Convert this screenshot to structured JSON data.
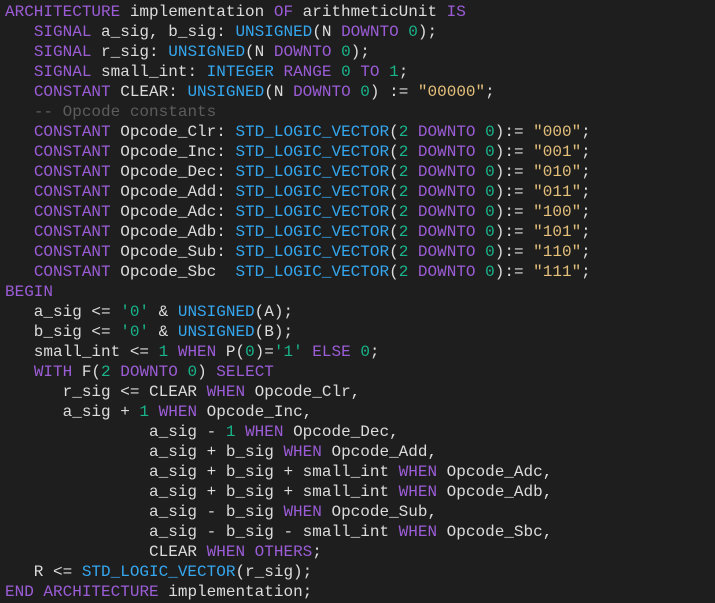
{
  "colors": {
    "background": "#1e1e1e",
    "kw": "#9b5cd6",
    "type": "#35a7ef",
    "num": "#18b58a",
    "str": "#e5c07b",
    "cmt": "#5c5c5c",
    "plain": "#dcdcdc"
  },
  "code": {
    "lines": [
      [
        [
          "kw",
          "ARCHITECTURE"
        ],
        [
          "plain",
          " implementation "
        ],
        [
          "kw",
          "OF"
        ],
        [
          "plain",
          " arithmeticUnit "
        ],
        [
          "kw",
          "IS"
        ]
      ],
      [
        [
          "plain",
          "   "
        ],
        [
          "kw",
          "SIGNAL"
        ],
        [
          "plain",
          " a_sig, b_sig: "
        ],
        [
          "type",
          "UNSIGNED"
        ],
        [
          "plain",
          "(N "
        ],
        [
          "kw",
          "DOWNTO"
        ],
        [
          "plain",
          " "
        ],
        [
          "num",
          "0"
        ],
        [
          "plain",
          ");"
        ]
      ],
      [
        [
          "plain",
          "   "
        ],
        [
          "kw",
          "SIGNAL"
        ],
        [
          "plain",
          " r_sig: "
        ],
        [
          "type",
          "UNSIGNED"
        ],
        [
          "plain",
          "(N "
        ],
        [
          "kw",
          "DOWNTO"
        ],
        [
          "plain",
          " "
        ],
        [
          "num",
          "0"
        ],
        [
          "plain",
          ");"
        ]
      ],
      [
        [
          "plain",
          "   "
        ],
        [
          "kw",
          "SIGNAL"
        ],
        [
          "plain",
          " small_int: "
        ],
        [
          "type",
          "INTEGER"
        ],
        [
          "plain",
          " "
        ],
        [
          "kw",
          "RANGE"
        ],
        [
          "plain",
          " "
        ],
        [
          "num",
          "0"
        ],
        [
          "plain",
          " "
        ],
        [
          "kw",
          "TO"
        ],
        [
          "plain",
          " "
        ],
        [
          "num",
          "1"
        ],
        [
          "plain",
          ";"
        ]
      ],
      [
        [
          "plain",
          "   "
        ],
        [
          "kw",
          "CONSTANT"
        ],
        [
          "plain",
          " CLEAR: "
        ],
        [
          "type",
          "UNSIGNED"
        ],
        [
          "plain",
          "(N "
        ],
        [
          "kw",
          "DOWNTO"
        ],
        [
          "plain",
          " "
        ],
        [
          "num",
          "0"
        ],
        [
          "plain",
          ") := "
        ],
        [
          "str",
          "\"00000\""
        ],
        [
          "plain",
          ";"
        ]
      ],
      [
        [
          "plain",
          "   "
        ],
        [
          "cmt",
          "-- Opcode constants"
        ]
      ],
      [
        [
          "plain",
          "   "
        ],
        [
          "kw",
          "CONSTANT"
        ],
        [
          "plain",
          " Opcode_Clr: "
        ],
        [
          "type",
          "STD_LOGIC_VECTOR"
        ],
        [
          "plain",
          "("
        ],
        [
          "num",
          "2"
        ],
        [
          "plain",
          " "
        ],
        [
          "kw",
          "DOWNTO"
        ],
        [
          "plain",
          " "
        ],
        [
          "num",
          "0"
        ],
        [
          "plain",
          ")"
        ],
        [
          "plain",
          ":= "
        ],
        [
          "str",
          "\"000\""
        ],
        [
          "plain",
          ";"
        ]
      ],
      [
        [
          "plain",
          "   "
        ],
        [
          "kw",
          "CONSTANT"
        ],
        [
          "plain",
          " Opcode_Inc: "
        ],
        [
          "type",
          "STD_LOGIC_VECTOR"
        ],
        [
          "plain",
          "("
        ],
        [
          "num",
          "2"
        ],
        [
          "plain",
          " "
        ],
        [
          "kw",
          "DOWNTO"
        ],
        [
          "plain",
          " "
        ],
        [
          "num",
          "0"
        ],
        [
          "plain",
          ")"
        ],
        [
          "plain",
          ":= "
        ],
        [
          "str",
          "\"001\""
        ],
        [
          "plain",
          ";"
        ]
      ],
      [
        [
          "plain",
          "   "
        ],
        [
          "kw",
          "CONSTANT"
        ],
        [
          "plain",
          " Opcode_Dec: "
        ],
        [
          "type",
          "STD_LOGIC_VECTOR"
        ],
        [
          "plain",
          "("
        ],
        [
          "num",
          "2"
        ],
        [
          "plain",
          " "
        ],
        [
          "kw",
          "DOWNTO"
        ],
        [
          "plain",
          " "
        ],
        [
          "num",
          "0"
        ],
        [
          "plain",
          ")"
        ],
        [
          "plain",
          ":= "
        ],
        [
          "str",
          "\"010\""
        ],
        [
          "plain",
          ";"
        ]
      ],
      [
        [
          "plain",
          "   "
        ],
        [
          "kw",
          "CONSTANT"
        ],
        [
          "plain",
          " Opcode_Add: "
        ],
        [
          "type",
          "STD_LOGIC_VECTOR"
        ],
        [
          "plain",
          "("
        ],
        [
          "num",
          "2"
        ],
        [
          "plain",
          " "
        ],
        [
          "kw",
          "DOWNTO"
        ],
        [
          "plain",
          " "
        ],
        [
          "num",
          "0"
        ],
        [
          "plain",
          ")"
        ],
        [
          "plain",
          ":= "
        ],
        [
          "str",
          "\"011\""
        ],
        [
          "plain",
          ";"
        ]
      ],
      [
        [
          "plain",
          "   "
        ],
        [
          "kw",
          "CONSTANT"
        ],
        [
          "plain",
          " Opcode_Adc: "
        ],
        [
          "type",
          "STD_LOGIC_VECTOR"
        ],
        [
          "plain",
          "("
        ],
        [
          "num",
          "2"
        ],
        [
          "plain",
          " "
        ],
        [
          "kw",
          "DOWNTO"
        ],
        [
          "plain",
          " "
        ],
        [
          "num",
          "0"
        ],
        [
          "plain",
          ")"
        ],
        [
          "plain",
          ":= "
        ],
        [
          "str",
          "\"100\""
        ],
        [
          "plain",
          ";"
        ]
      ],
      [
        [
          "plain",
          "   "
        ],
        [
          "kw",
          "CONSTANT"
        ],
        [
          "plain",
          " Opcode_Adb: "
        ],
        [
          "type",
          "STD_LOGIC_VECTOR"
        ],
        [
          "plain",
          "("
        ],
        [
          "num",
          "2"
        ],
        [
          "plain",
          " "
        ],
        [
          "kw",
          "DOWNTO"
        ],
        [
          "plain",
          " "
        ],
        [
          "num",
          "0"
        ],
        [
          "plain",
          ")"
        ],
        [
          "plain",
          ":= "
        ],
        [
          "str",
          "\"101\""
        ],
        [
          "plain",
          ";"
        ]
      ],
      [
        [
          "plain",
          "   "
        ],
        [
          "kw",
          "CONSTANT"
        ],
        [
          "plain",
          " Opcode_Sub: "
        ],
        [
          "type",
          "STD_LOGIC_VECTOR"
        ],
        [
          "plain",
          "("
        ],
        [
          "num",
          "2"
        ],
        [
          "plain",
          " "
        ],
        [
          "kw",
          "DOWNTO"
        ],
        [
          "plain",
          " "
        ],
        [
          "num",
          "0"
        ],
        [
          "plain",
          ")"
        ],
        [
          "plain",
          ":= "
        ],
        [
          "str",
          "\"110\""
        ],
        [
          "plain",
          ";"
        ]
      ],
      [
        [
          "plain",
          "   "
        ],
        [
          "kw",
          "CONSTANT"
        ],
        [
          "plain",
          " Opcode_Sbc  "
        ],
        [
          "type",
          "STD_LOGIC_VECTOR"
        ],
        [
          "plain",
          "("
        ],
        [
          "num",
          "2"
        ],
        [
          "plain",
          " "
        ],
        [
          "kw",
          "DOWNTO"
        ],
        [
          "plain",
          " "
        ],
        [
          "num",
          "0"
        ],
        [
          "plain",
          ")"
        ],
        [
          "plain",
          ":= "
        ],
        [
          "str",
          "\"111\""
        ],
        [
          "plain",
          ";"
        ]
      ],
      [
        [
          "kw",
          "BEGIN"
        ]
      ],
      [
        [
          "plain",
          "   a_sig <= "
        ],
        [
          "num",
          "'0'"
        ],
        [
          "plain",
          " & "
        ],
        [
          "type",
          "UNSIGNED"
        ],
        [
          "plain",
          "(A);"
        ]
      ],
      [
        [
          "plain",
          "   b_sig <= "
        ],
        [
          "num",
          "'0'"
        ],
        [
          "plain",
          " & "
        ],
        [
          "type",
          "UNSIGNED"
        ],
        [
          "plain",
          "(B);"
        ]
      ],
      [
        [
          "plain",
          "   small_int <= "
        ],
        [
          "num",
          "1"
        ],
        [
          "plain",
          " "
        ],
        [
          "kw",
          "WHEN"
        ],
        [
          "plain",
          " P("
        ],
        [
          "num",
          "0"
        ],
        [
          "plain",
          ")="
        ],
        [
          "num",
          "'1'"
        ],
        [
          "plain",
          " "
        ],
        [
          "kw",
          "ELSE"
        ],
        [
          "plain",
          " "
        ],
        [
          "num",
          "0"
        ],
        [
          "plain",
          ";"
        ]
      ],
      [
        [
          "plain",
          "   "
        ],
        [
          "kw",
          "WITH"
        ],
        [
          "plain",
          " F("
        ],
        [
          "num",
          "2"
        ],
        [
          "plain",
          " "
        ],
        [
          "kw",
          "DOWNTO"
        ],
        [
          "plain",
          " "
        ],
        [
          "num",
          "0"
        ],
        [
          "plain",
          ") "
        ],
        [
          "kw",
          "SELECT"
        ]
      ],
      [
        [
          "plain",
          "      r_sig <= CLEAR "
        ],
        [
          "kw",
          "WHEN"
        ],
        [
          "plain",
          " Opcode_Clr,"
        ]
      ],
      [
        [
          "plain",
          "      a_sig + "
        ],
        [
          "num",
          "1"
        ],
        [
          "plain",
          " "
        ],
        [
          "kw",
          "WHEN"
        ],
        [
          "plain",
          " Opcode_Inc,"
        ]
      ],
      [
        [
          "plain",
          "               a_sig - "
        ],
        [
          "num",
          "1"
        ],
        [
          "plain",
          " "
        ],
        [
          "kw",
          "WHEN"
        ],
        [
          "plain",
          " Opcode_Dec,"
        ]
      ],
      [
        [
          "plain",
          "               a_sig + b_sig "
        ],
        [
          "kw",
          "WHEN"
        ],
        [
          "plain",
          " Opcode_Add,"
        ]
      ],
      [
        [
          "plain",
          "               a_sig + b_sig + small_int "
        ],
        [
          "kw",
          "WHEN"
        ],
        [
          "plain",
          " Opcode_Adc,"
        ]
      ],
      [
        [
          "plain",
          "               a_sig + b_sig + small_int "
        ],
        [
          "kw",
          "WHEN"
        ],
        [
          "plain",
          " Opcode_Adb,"
        ]
      ],
      [
        [
          "plain",
          "               a_sig - b_sig "
        ],
        [
          "kw",
          "WHEN"
        ],
        [
          "plain",
          " Opcode_Sub,"
        ]
      ],
      [
        [
          "plain",
          "               a_sig - b_sig - small_int "
        ],
        [
          "kw",
          "WHEN"
        ],
        [
          "plain",
          " Opcode_Sbc,"
        ]
      ],
      [
        [
          "plain",
          "               CLEAR "
        ],
        [
          "kw",
          "WHEN"
        ],
        [
          "plain",
          " "
        ],
        [
          "kw",
          "OTHERS"
        ],
        [
          "plain",
          ";"
        ]
      ],
      [
        [
          "plain",
          "   R <= "
        ],
        [
          "type",
          "STD_LOGIC_VECTOR"
        ],
        [
          "plain",
          "(r_sig);"
        ]
      ],
      [
        [
          "kw",
          "END"
        ],
        [
          "plain",
          " "
        ],
        [
          "kw",
          "ARCHITECTURE"
        ],
        [
          "plain",
          " implementation;"
        ]
      ]
    ]
  }
}
